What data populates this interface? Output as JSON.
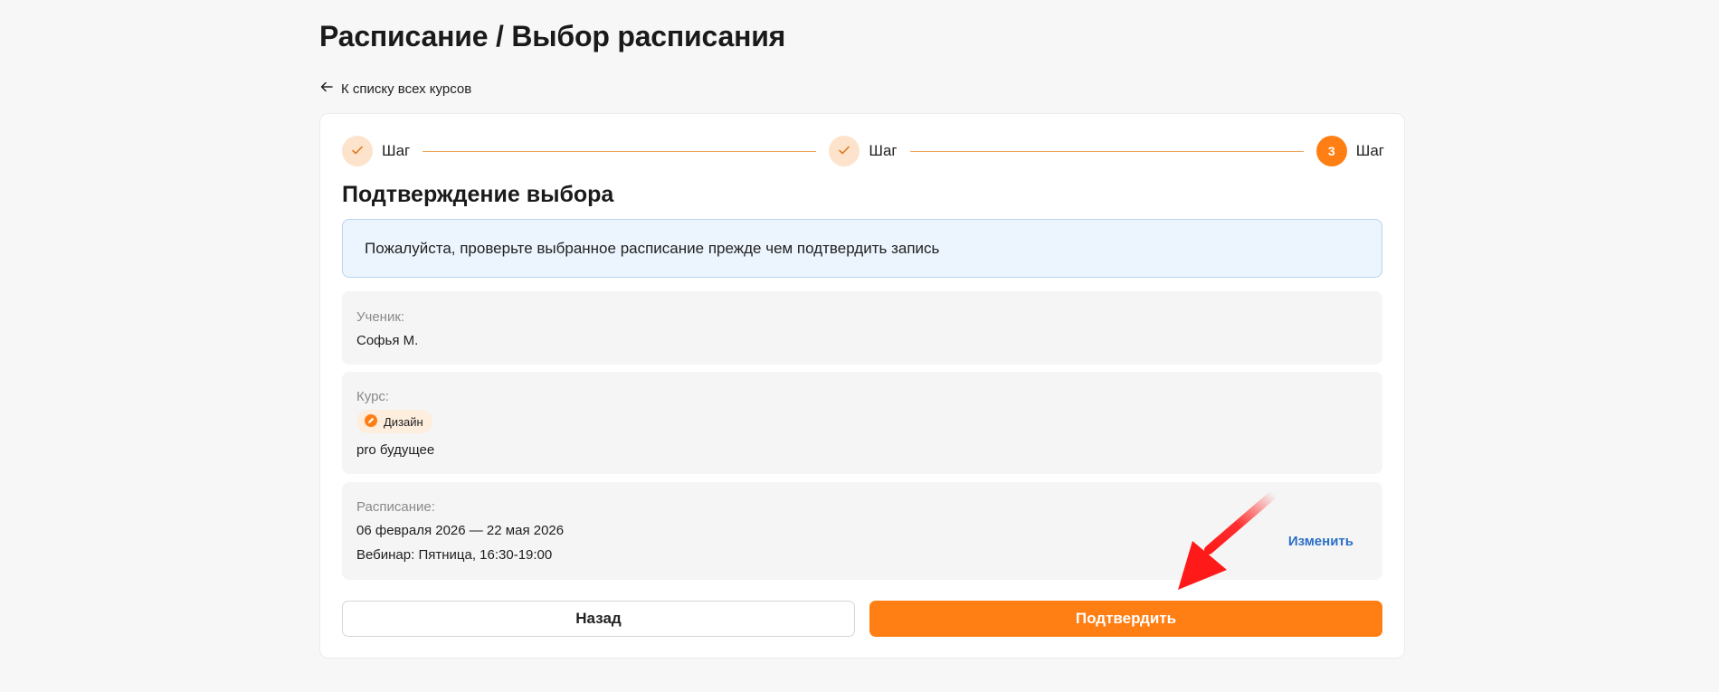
{
  "page": {
    "title": "Расписание / Выбор расписания",
    "back_link": "К списку всех курсов"
  },
  "stepper": {
    "steps": [
      {
        "label": "Шаг",
        "state": "done",
        "icon": "check-icon"
      },
      {
        "label": "Шаг",
        "state": "done",
        "icon": "check-icon"
      },
      {
        "label": "Шаг",
        "state": "active",
        "number": "3"
      }
    ]
  },
  "section": {
    "title": "Подтверждение выбора",
    "notice": "Пожалуйста, проверьте выбранное расписание прежде чем подтвердить запись"
  },
  "details": {
    "student": {
      "label": "Ученик:",
      "value": "Софья М."
    },
    "course": {
      "label": "Курс:",
      "tag": "Дизайн",
      "tag_icon": "pen-icon",
      "name": "pro будущее"
    },
    "schedule": {
      "label": "Расписание:",
      "dates": "06 февраля 2026 — 22 мая 2026",
      "webinar": "Вебинар: Пятница, 16:30-19:00",
      "change_label": "Изменить"
    }
  },
  "actions": {
    "back_label": "Назад",
    "confirm_label": "Подтвердить"
  },
  "colors": {
    "accent": "#ff7f14",
    "accent_light": "#fde3cb",
    "link": "#2b6fc7",
    "info_bg": "#ecf4fd",
    "annotation": "#ff1a1a"
  }
}
